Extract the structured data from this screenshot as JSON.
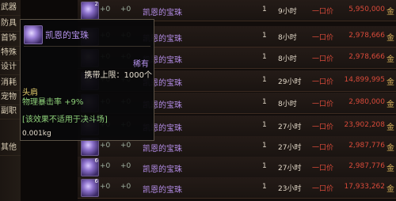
{
  "sidebar": {
    "categories": [
      "武器",
      "防具",
      "首饰",
      "特殊",
      "设计",
      "消耗",
      "宠物",
      "副职",
      "其他"
    ]
  },
  "rows": [
    {
      "count": "2",
      "plus1": "+0",
      "plus2": "+0",
      "name": "凯恩的宝珠",
      "qty": "1",
      "time": "9小时",
      "type": "一口价",
      "price": "5,950,000",
      "currency": "金"
    },
    {
      "count": "",
      "plus1": "+0",
      "plus2": "+0",
      "name": "凯恩的宝珠",
      "qty": "1",
      "time": "8小时",
      "type": "一口价",
      "price": "2,978,666",
      "currency": "金"
    },
    {
      "count": "",
      "plus1": "+0",
      "plus2": "+0",
      "name": "凯恩的宝珠",
      "qty": "1",
      "time": "8小时",
      "type": "一口价",
      "price": "2,978,666",
      "currency": "金"
    },
    {
      "count": "",
      "plus1": "+0",
      "plus2": "+0",
      "name": "凯恩的宝珠",
      "qty": "1",
      "time": "29小时",
      "type": "一口价",
      "price": "14,899,995",
      "currency": "金"
    },
    {
      "count": "",
      "plus1": "+0",
      "plus2": "+0",
      "name": "凯恩的宝珠",
      "qty": "1",
      "time": "8小时",
      "type": "一口价",
      "price": "2,980,000",
      "currency": "金"
    },
    {
      "count": "",
      "plus1": "+0",
      "plus2": "+0",
      "name": "凯恩的宝珠",
      "qty": "1",
      "time": "27小时",
      "type": "一口价",
      "price": "23,902,208",
      "currency": "金"
    },
    {
      "count": "",
      "plus1": "+0",
      "plus2": "+0",
      "name": "凯恩的宝珠",
      "qty": "1",
      "time": "27小时",
      "type": "一口价",
      "price": "2,987,776",
      "currency": "金"
    },
    {
      "count": "6",
      "plus1": "+0",
      "plus2": "+0",
      "name": "凯恩的宝珠",
      "qty": "1",
      "time": "27小时",
      "type": "一口价",
      "price": "2,987,776",
      "currency": "金"
    },
    {
      "count": "6",
      "plus1": "+0",
      "plus2": "+0",
      "name": "凯恩的宝珠",
      "qty": "1",
      "time": "23小时",
      "type": "一口价",
      "price": "17,933,262",
      "currency": "金"
    }
  ],
  "tooltip": {
    "name": "凯恩的宝珠",
    "rarity": "稀有",
    "carry_limit": "携带上限：1000个",
    "slot": "头肩",
    "stat": "物理暴击率 +9%",
    "note": "[该效果不适用于决斗场]",
    "weight": "0.001kg"
  }
}
